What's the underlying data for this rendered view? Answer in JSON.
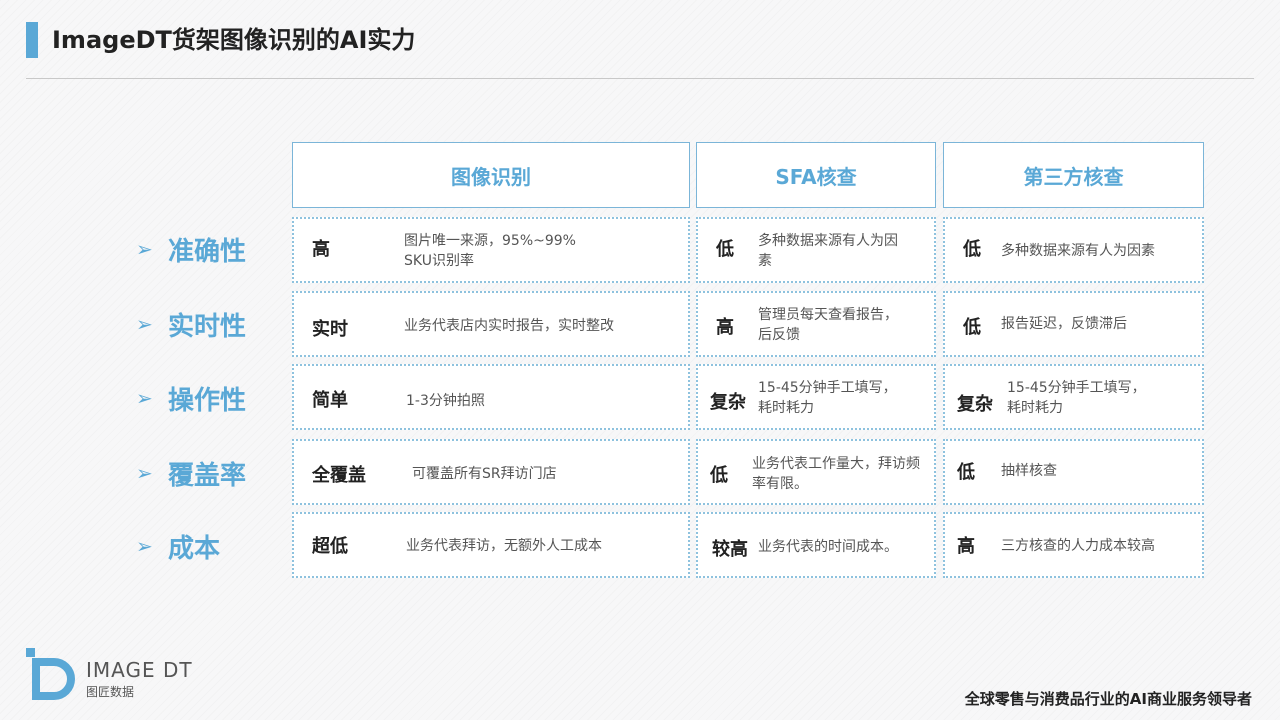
{
  "title": "ImageDT货架图像识别的AI实力",
  "columns": [
    "图像识别",
    "SFA核查",
    "第三方核查"
  ],
  "rows": [
    {
      "label": "准确性",
      "cells": [
        {
          "level": "高",
          "desc": "图片唯一来源，95%~99%\nSKU识别率"
        },
        {
          "level": "低",
          "desc": "多种数据来源有人为因\n素"
        },
        {
          "level": "低",
          "desc": "多种数据来源有人为因素"
        }
      ]
    },
    {
      "label": "实时性",
      "cells": [
        {
          "level": "实时",
          "desc": "业务代表店内实时报告，实时整改"
        },
        {
          "level": "高",
          "desc": "管理员每天查看报告，\n后反馈"
        },
        {
          "level": "低",
          "desc": "报告延迟，反馈滞后"
        }
      ]
    },
    {
      "label": "操作性",
      "cells": [
        {
          "level": "简单",
          "desc": "1-3分钟拍照"
        },
        {
          "level": "复杂",
          "desc": "15-45分钟手工填写，\n耗时耗力"
        },
        {
          "level": "复杂",
          "desc": "15-45分钟手工填写，\n耗时耗力"
        }
      ]
    },
    {
      "label": "覆盖率",
      "cells": [
        {
          "level": "全覆盖",
          "desc": "可覆盖所有SR拜访门店"
        },
        {
          "level": "低",
          "desc": "业务代表工作量大，拜访频\n率有限。"
        },
        {
          "level": "低",
          "desc": "抽样核查"
        }
      ]
    },
    {
      "label": "成本",
      "cells": [
        {
          "level": "超低",
          "desc": "业务代表拜访，无额外人工成本"
        },
        {
          "level": "较高",
          "desc": "业务代表的时间成本。"
        },
        {
          "level": "高",
          "desc": "三方核查的人力成本较高"
        }
      ]
    }
  ],
  "arrow_glyph": "➢",
  "logo": {
    "name": "IMAGE DT",
    "sub": "图匠数据"
  },
  "footer": "全球零售与消费品行业的AI商业服务领导者",
  "colors": {
    "accent": "#5aa8d6",
    "border": "#8ec2de"
  }
}
